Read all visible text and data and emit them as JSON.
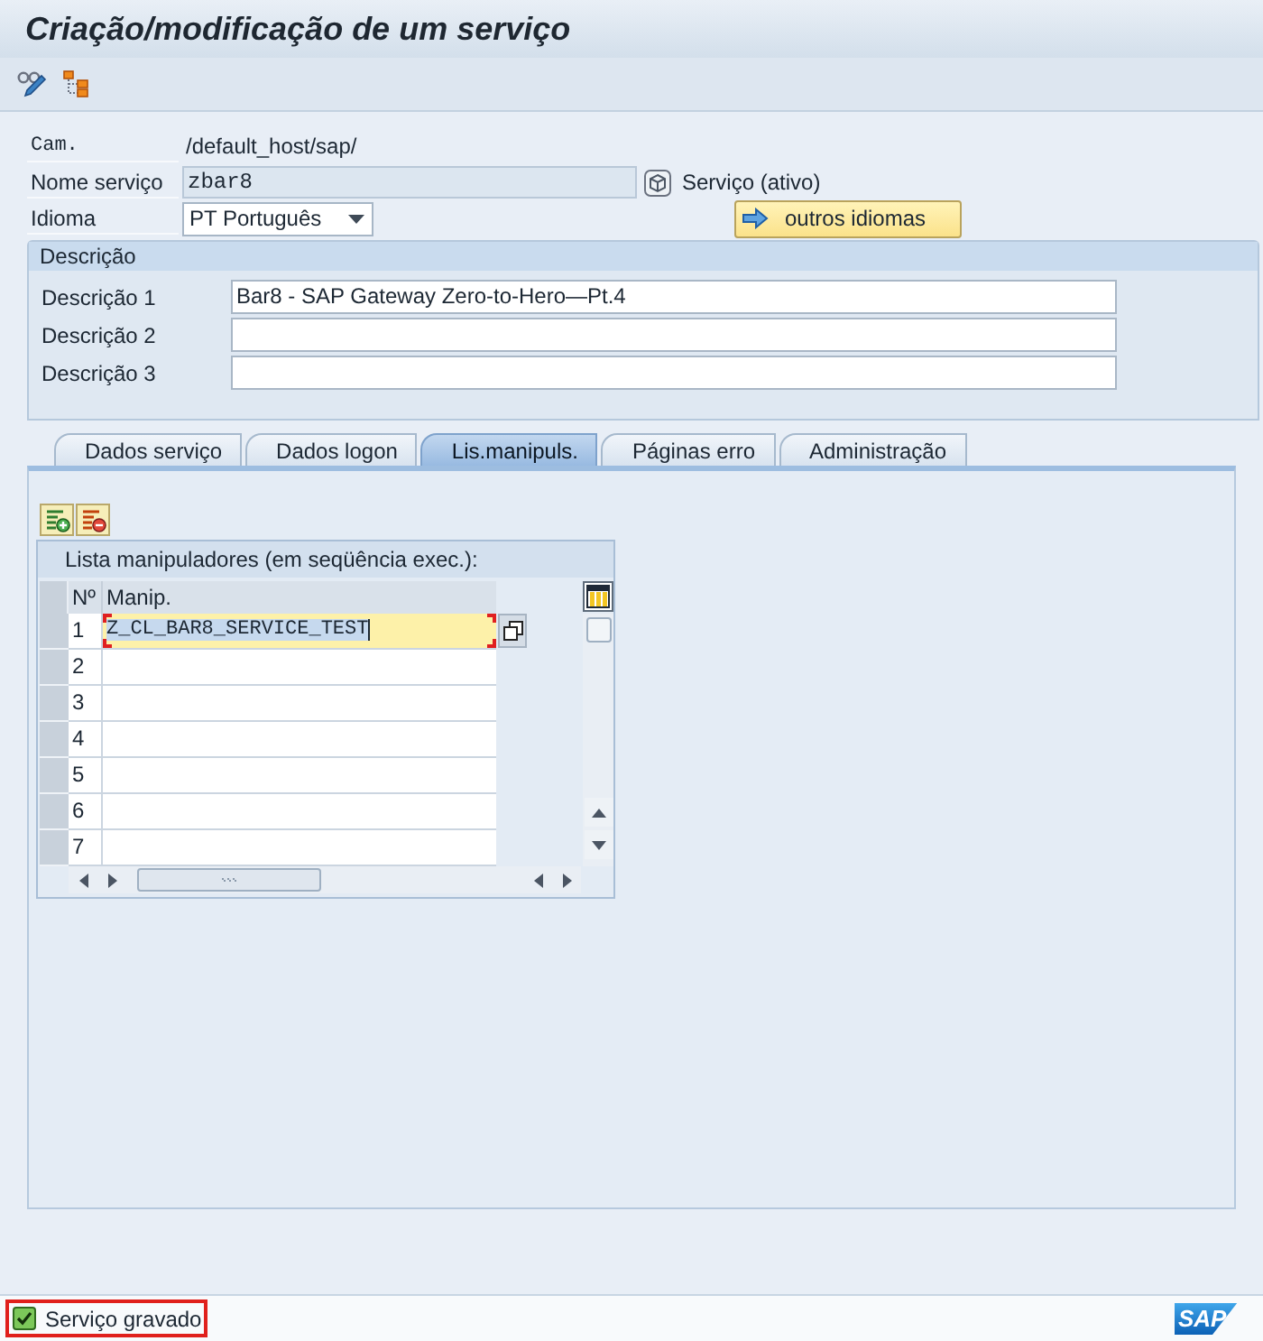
{
  "window": {
    "title": "Criação/modificação de um serviço"
  },
  "fields": [
    {
      "kind": "text",
      "label": "Cam.",
      "value": "/default_host/sap/"
    },
    {
      "kind": "readonly",
      "label": "Nome serviço",
      "value": "zbar8",
      "status": "Serviço (ativo)"
    },
    {
      "kind": "dropdown",
      "label": "Idioma",
      "value": "PT Português",
      "button": "outros idiomas"
    }
  ],
  "description": {
    "title": "Descrição",
    "rows": [
      {
        "label": "Descrição 1",
        "value": "Bar8 - SAP Gateway Zero-to-Hero—Pt.4"
      },
      {
        "label": "Descrição 2"
      },
      {
        "label": "Descrição 3"
      }
    ]
  },
  "tabs": [
    {
      "label": "Dados serviço",
      "selected": false
    },
    {
      "label": "Dados logon",
      "selected": false
    },
    {
      "label": "Lis.manipuls.",
      "selected": true
    },
    {
      "label": "Páginas erro",
      "selected": false
    },
    {
      "label": "Administração",
      "selected": false
    }
  ],
  "handler_list": {
    "title": "Lista manipuladores (em seqüência exec.):",
    "columns": [
      "Nº",
      "Manip."
    ],
    "rows": [
      {
        "number": "1",
        "handler": "Z_CL_BAR8_SERVICE_TEST",
        "focused": true
      },
      {
        "number": "2",
        "focused": false
      },
      {
        "number": "3",
        "focused": false
      },
      {
        "number": "4",
        "focused": false
      },
      {
        "number": "5",
        "focused": false
      },
      {
        "number": "6",
        "focused": false
      },
      {
        "number": "7",
        "focused": false
      }
    ]
  },
  "status_bar": {
    "kind": "success",
    "message": "Serviço gravado",
    "highlighted": true,
    "logo": "SAP"
  }
}
